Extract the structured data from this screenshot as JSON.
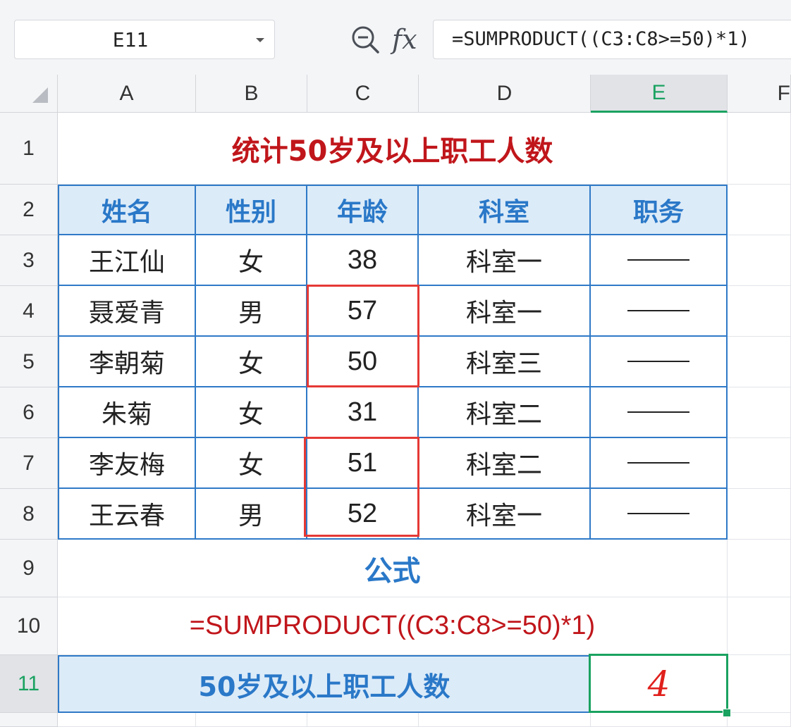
{
  "formula_bar": {
    "name_box": "E11",
    "formula": "=SUMPRODUCT((C3:C8>=50)*1)",
    "fx_label": "fx"
  },
  "columns": [
    "A",
    "B",
    "C",
    "D",
    "E",
    "F"
  ],
  "rows": [
    "1",
    "2",
    "3",
    "4",
    "5",
    "6",
    "7",
    "8",
    "9",
    "10",
    "11"
  ],
  "sheet": {
    "title": "统计50岁及以上职工人数",
    "headers": [
      "姓名",
      "性别",
      "年龄",
      "科室",
      "职务"
    ],
    "records": [
      {
        "name": "王江仙",
        "gender": "女",
        "age": "38",
        "dept": "科室一"
      },
      {
        "name": "聂爱青",
        "gender": "男",
        "age": "57",
        "dept": "科室一"
      },
      {
        "name": "李朝菊",
        "gender": "女",
        "age": "50",
        "dept": "科室三"
      },
      {
        "name": "朱菊",
        "gender": "女",
        "age": "31",
        "dept": "科室二"
      },
      {
        "name": "李友梅",
        "gender": "女",
        "age": "51",
        "dept": "科室二"
      },
      {
        "name": "王云春",
        "gender": "男",
        "age": "52",
        "dept": "科室一"
      }
    ],
    "formula_label": "公式",
    "formula_text": "=SUMPRODUCT((C3:C8>=50)*1)",
    "result_label": "50岁及以上职工人数",
    "result_value": "4"
  },
  "selected_cell": "E11",
  "colors": {
    "accent_green": "#1aa260",
    "title_red": "#c0161b",
    "header_blue": "#2a78c8",
    "header_fill": "#dcebf8",
    "highlight_red": "#e53935"
  }
}
